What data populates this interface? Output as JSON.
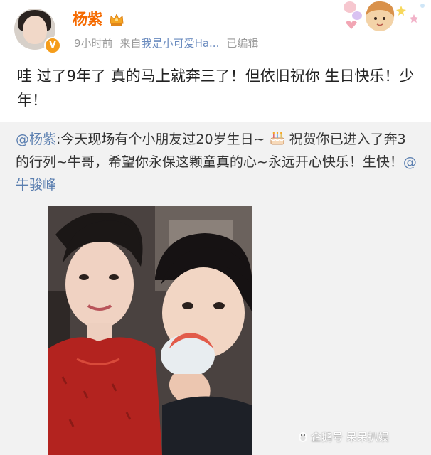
{
  "post": {
    "username": "杨紫",
    "time": "9小时前",
    "source_prefix": "来自",
    "source_app": "我是小可爱Ha...",
    "edited": "已编辑",
    "text": "哇 过了9年了 真的马上就奔三了！但依旧祝你 生日快乐！少年！"
  },
  "repost": {
    "author": "@杨紫",
    "text_part1": ":今天现场有个小朋友过20岁生日~",
    "text_part2": "祝贺你已进入了奔3的行列~牛哥，希望你永保这颗童真的心~永远开心快乐！生快！",
    "mention": "@牛骏峰"
  },
  "watermark": "企鹅号 呆呆扒娱",
  "icons": {
    "verified": "verified-v-icon",
    "crown": "crown-icon",
    "cake": "birthday-cake-icon",
    "watermark": "penguin-logo-icon"
  },
  "colors": {
    "username": "#f56a00",
    "link": "#5b7fb0",
    "meta": "#999999",
    "verified": "#f59d1b"
  }
}
